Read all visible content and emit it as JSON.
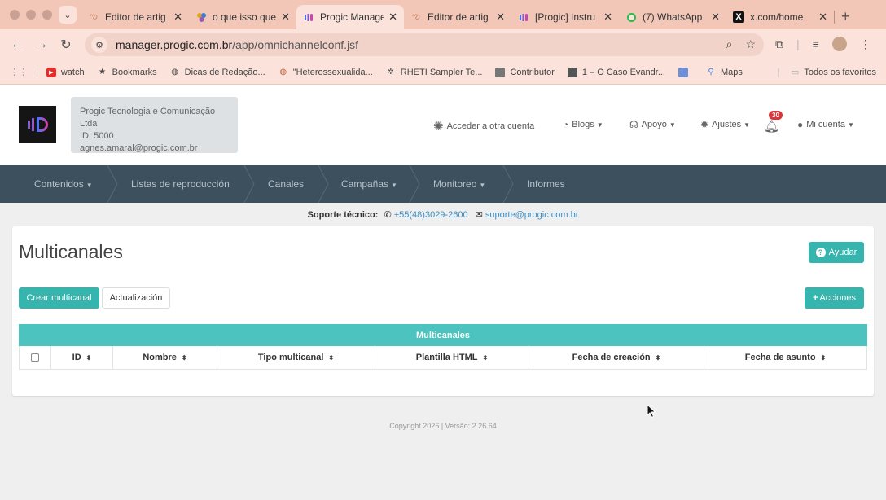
{
  "browser": {
    "tabs": [
      {
        "title": "Editor de artig",
        "icon": "tag-icon"
      },
      {
        "title": "o que isso que",
        "icon": "colorful-logo-icon"
      },
      {
        "title": "Progic Manage",
        "icon": "progic-icon",
        "active": true
      },
      {
        "title": "Editor de artig",
        "icon": "tag-icon"
      },
      {
        "title": "[Progic] Instru",
        "icon": "progic-icon"
      },
      {
        "title": "(7) WhatsApp",
        "icon": "whatsapp-icon"
      },
      {
        "title": "x.com/home",
        "icon": "x-icon"
      }
    ],
    "url_host": "manager.progic.com.br",
    "url_path": "/app/omnichannelconf.jsf",
    "bookmarks": [
      {
        "label": "watch",
        "icon": "youtube-icon"
      },
      {
        "label": "Bookmarks",
        "icon": "star-icon"
      },
      {
        "label": "Dicas de Redação...",
        "icon": "globe-icon"
      },
      {
        "label": "\"Heterossexualida...",
        "icon": "globe-icon"
      },
      {
        "label": "RHETI Sampler Te...",
        "icon": "gear-icon"
      },
      {
        "label": "Contributor",
        "icon": "image-icon"
      },
      {
        "label": "1 – O Caso Evandr...",
        "icon": "book-icon"
      },
      {
        "label": "",
        "icon": "doc-icon"
      },
      {
        "label": "Maps",
        "icon": "map-pin-icon"
      }
    ],
    "all_bookmarks": "Todos os favoritos"
  },
  "header": {
    "org_name": "Progic Tecnologia e Comunicação Ltda",
    "org_id": "ID: 5000",
    "user_email": "agnes.amaral@progic.com.br",
    "switch_account": "Acceder a otra cuenta",
    "blogs": "Blogs",
    "support": "Apoyo",
    "settings": "Ajustes",
    "notifications_count": "30",
    "account": "Mi cuenta"
  },
  "nav": {
    "items": [
      "Contenidos",
      "Listas de reproducción",
      "Canales",
      "Campañas",
      "Monitoreo",
      "Informes"
    ]
  },
  "support_bar": {
    "label": "Soporte técnico:",
    "phone": "+55(48)3029-2600",
    "email": "suporte@progic.com.br"
  },
  "page": {
    "title": "Multicanales",
    "help_button": "Ayudar",
    "create_button": "Crear multicanal",
    "update_button": "Actualización",
    "actions_button": "Acciones",
    "table_caption": "Multicanales",
    "columns": [
      "ID",
      "Nombre",
      "Tipo multicanal",
      "Plantilla HTML",
      "Fecha de creación",
      "Fecha de asunto"
    ]
  },
  "footer": {
    "text": "Copyright 2026 | Versão: 2.26.64"
  },
  "colors": {
    "accent": "#35b5ad",
    "nav_bg": "#3d505e",
    "badge": "#d9353b",
    "chrome": "#fbe2da"
  }
}
